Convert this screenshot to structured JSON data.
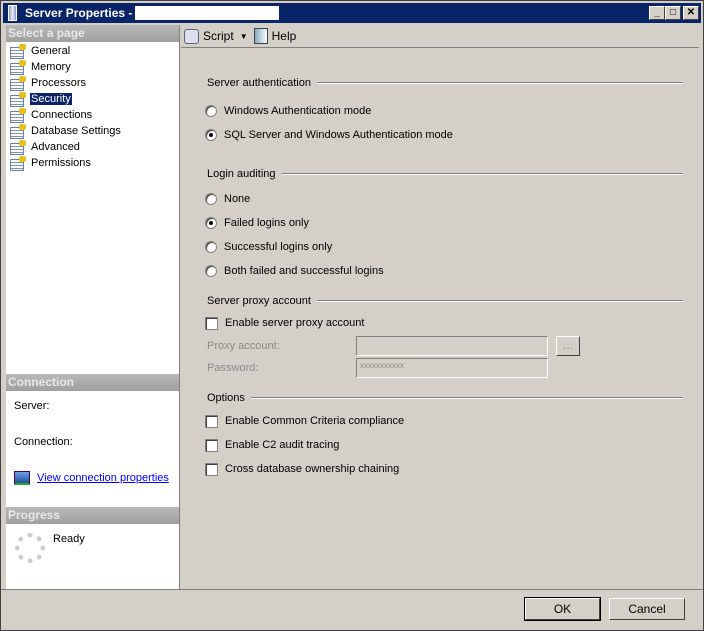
{
  "window": {
    "title": "Server Properties -",
    "icons": [
      "server-icon",
      "minimize-icon",
      "maximize-icon",
      "close-icon"
    ]
  },
  "left": {
    "select_header": "Select a page",
    "pages": [
      {
        "label": "General"
      },
      {
        "label": "Memory"
      },
      {
        "label": "Processors"
      },
      {
        "label": "Security",
        "selected": true
      },
      {
        "label": "Connections"
      },
      {
        "label": "Database Settings"
      },
      {
        "label": "Advanced"
      },
      {
        "label": "Permissions"
      }
    ],
    "connection_header": "Connection",
    "server_label": "Server:",
    "connection_label": "Connection:",
    "view_link": "View connection properties",
    "progress_header": "Progress",
    "progress_status": "Ready"
  },
  "toolbar": {
    "script": "Script",
    "help": "Help"
  },
  "auth": {
    "title": "Server authentication",
    "options": [
      "Windows Authentication mode",
      "SQL Server and Windows Authentication mode"
    ],
    "selected": 1
  },
  "audit": {
    "title": "Login auditing",
    "options": [
      "None",
      "Failed logins only",
      "Successful logins only",
      "Both failed and successful logins"
    ],
    "selected": 1
  },
  "proxy": {
    "title": "Server proxy account",
    "enable": "Enable server proxy account",
    "account_label": "Proxy account:",
    "account_value": "",
    "password_label": "Password:",
    "password_value": "xxxxxxxxxxx",
    "browse": "..."
  },
  "options": {
    "title": "Options",
    "items": [
      "Enable Common Criteria compliance",
      "Enable C2 audit tracing",
      "Cross database ownership chaining"
    ]
  },
  "buttons": {
    "ok": "OK",
    "cancel": "Cancel"
  }
}
